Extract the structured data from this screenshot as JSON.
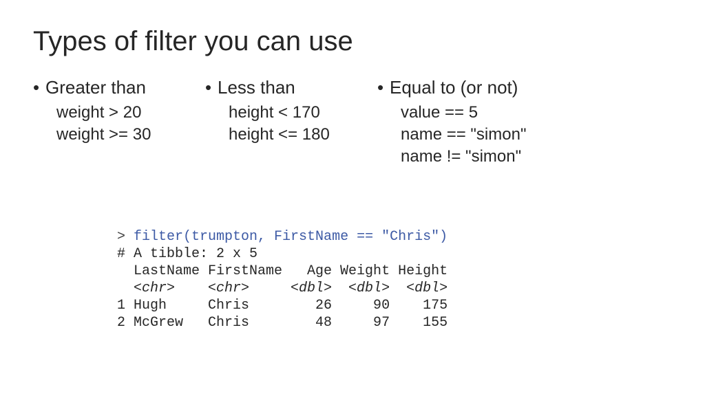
{
  "title": "Types of filter you can use",
  "columns": [
    {
      "header": "Greater than",
      "examples": [
        "weight > 20",
        "weight >= 30"
      ]
    },
    {
      "header": "Less than",
      "examples": [
        "height < 170",
        "height <= 180"
      ]
    },
    {
      "header": "Equal to (or not)",
      "examples": [
        "value == 5",
        "name == \"simon\"",
        "name != \"simon\""
      ]
    }
  ],
  "code": {
    "prompt": "> ",
    "command": "filter(trumpton, FirstName == \"Chris\")",
    "header_line": "# A tibble: 2 x 5",
    "colnames": "  LastName FirstName   Age Weight Height",
    "coltypes": "  <chr>    <chr>     <dbl>  <dbl>  <dbl>",
    "rows": [
      "1 Hugh     Chris        26     90    175",
      "2 McGrew   Chris        48     97    155"
    ]
  },
  "chart_data": {
    "type": "table",
    "title": "filter result",
    "columns": [
      "LastName",
      "FirstName",
      "Age",
      "Weight",
      "Height"
    ],
    "coltypes": [
      "chr",
      "chr",
      "dbl",
      "dbl",
      "dbl"
    ],
    "rows": [
      {
        "LastName": "Hugh",
        "FirstName": "Chris",
        "Age": 26,
        "Weight": 90,
        "Height": 175
      },
      {
        "LastName": "McGrew",
        "FirstName": "Chris",
        "Age": 48,
        "Weight": 97,
        "Height": 155
      }
    ]
  }
}
